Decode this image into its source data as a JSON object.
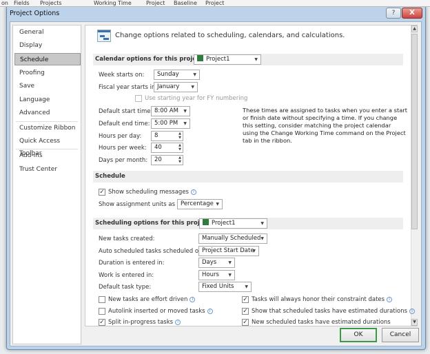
{
  "background_app": {
    "tabs": [
      "on",
      "Fields",
      "Projects",
      "Working Time",
      "Project",
      "Baseline",
      "Project"
    ]
  },
  "dialog": {
    "title": "Project Options",
    "help_label": "?",
    "close_label": "X"
  },
  "sidebar": {
    "items": [
      {
        "label": "General"
      },
      {
        "label": "Display"
      },
      {
        "label": "Schedule",
        "selected": true
      },
      {
        "label": "Proofing"
      },
      {
        "label": "Save"
      },
      {
        "label": "Language"
      },
      {
        "label": "Advanced"
      },
      {
        "label": "Customize Ribbon"
      },
      {
        "label": "Quick Access Toolbar"
      },
      {
        "label": "Add-ins"
      },
      {
        "label": "Trust Center"
      }
    ]
  },
  "header": {
    "text": "Change options related to scheduling, calendars, and calculations."
  },
  "calendar": {
    "section_label": "Calendar options for this project:",
    "project": "Project1",
    "week_starts_label": "Week starts on:",
    "week_starts": "Sunday",
    "fiscal_label": "Fiscal year starts in:",
    "fiscal": "January",
    "fy_numbering_label": "Use starting year for FY numbering",
    "fy_numbering": false,
    "start_time_label": "Default start time:",
    "start_time": "8:00 AM",
    "end_time_label": "Default end time:",
    "end_time": "5:00 PM",
    "hours_day_label": "Hours per day:",
    "hours_day": "8",
    "hours_week_label": "Hours per week:",
    "hours_week": "40",
    "days_month_label": "Days per month:",
    "days_month": "20",
    "note": "These times are assigned to tasks when you enter a start or finish date without specifying a time. If you change this setting, consider matching the project calendar using the Change Working Time command on the Project tab in the ribbon."
  },
  "schedule": {
    "section_label": "Schedule",
    "show_messages_label": "Show scheduling messages",
    "show_messages": true,
    "units_label": "Show assignment units as a:",
    "units": "Percentage"
  },
  "scheduling": {
    "section_label": "Scheduling options for this project:",
    "project": "Project1",
    "new_tasks_label": "New tasks created:",
    "new_tasks": "Manually Scheduled",
    "auto_label": "Auto scheduled tasks scheduled on:",
    "auto": "Project Start Date",
    "duration_label": "Duration is entered in:",
    "duration": "Days",
    "work_label": "Work is entered in:",
    "work": "Hours",
    "task_type_label": "Default task type:",
    "task_type": "Fixed Units",
    "checks": [
      {
        "label": "New tasks are effort driven",
        "checked": false
      },
      {
        "label": "Autolink inserted or moved tasks",
        "checked": false
      },
      {
        "label": "Split in-progress tasks",
        "checked": true
      },
      {
        "label": "Tasks will always honor their constraint dates",
        "checked": true
      },
      {
        "label": "Show that scheduled tasks have estimated durations",
        "checked": true
      },
      {
        "label": "New scheduled tasks have estimated durations",
        "checked": true
      }
    ]
  },
  "buttons": {
    "ok": "OK",
    "cancel": "Cancel"
  },
  "colors": {
    "selected_nav": "#c8c8c8",
    "section_bg": "#eeeeee",
    "ok_border": "#3a9a4a"
  }
}
